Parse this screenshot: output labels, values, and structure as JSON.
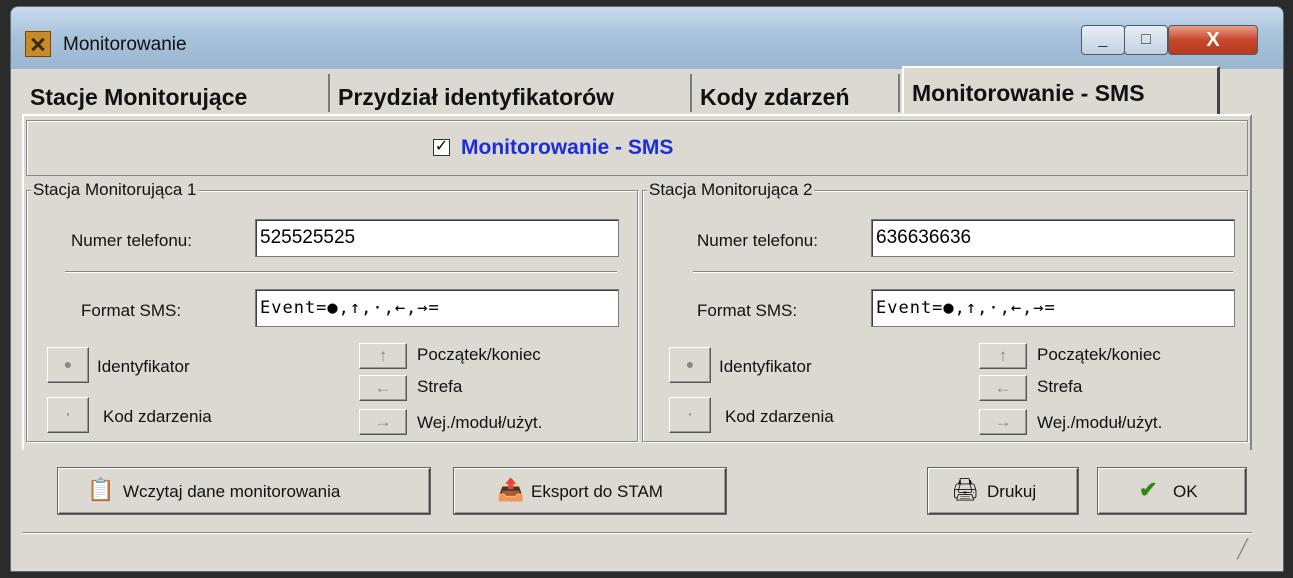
{
  "window": {
    "title": "Monitorowanie",
    "close_label": "X",
    "min_label": "_",
    "max_label": "□"
  },
  "tabs": [
    {
      "label": "Stacje Monitorujące"
    },
    {
      "label": "Przydział identyfikatorów"
    },
    {
      "label": "Kody zdarzeń"
    },
    {
      "label": "Monitorowanie - SMS",
      "active": true
    }
  ],
  "sms": {
    "checked": true,
    "check_glyph": "✓",
    "label": "Monitorowanie - SMS",
    "label_color": "#1b2ed8"
  },
  "stations": [
    {
      "legend": "Stacja Monitorująca 1",
      "phone_label": "Numer telefonu:",
      "phone_value": "525525525",
      "format_label": "Format SMS:",
      "format_value": "Event=●,↑,·,←,→=",
      "buttons": [
        {
          "icon": "●",
          "label": "Identyfikator"
        },
        {
          "icon": "·",
          "label": "Kod zdarzenia"
        },
        {
          "icon": "↑",
          "label": "Początek/koniec"
        },
        {
          "icon": "←",
          "label": "Strefa"
        },
        {
          "icon": "→",
          "label": "Wej./moduł/użyt."
        }
      ]
    },
    {
      "legend": "Stacja Monitorująca 2",
      "phone_label": "Numer telefonu:",
      "phone_value": "636636636",
      "format_label": "Format SMS:",
      "format_value": "Event=●,↑,·,←,→=",
      "buttons": [
        {
          "icon": "●",
          "label": "Identyfikator"
        },
        {
          "icon": "·",
          "label": "Kod zdarzenia"
        },
        {
          "icon": "↑",
          "label": "Początek/koniec"
        },
        {
          "icon": "←",
          "label": "Strefa"
        },
        {
          "icon": "→",
          "label": "Wej./moduł/użyt."
        }
      ]
    }
  ],
  "footer": {
    "load_label": "Wczytaj dane monitorowania",
    "export_label": "Eksport do STAM",
    "print_label": "Drukuj",
    "ok_label": "OK"
  },
  "icons": {
    "load": "load-data-icon",
    "export": "export-icon",
    "print": "printer-icon",
    "ok": "checkmark-icon"
  }
}
